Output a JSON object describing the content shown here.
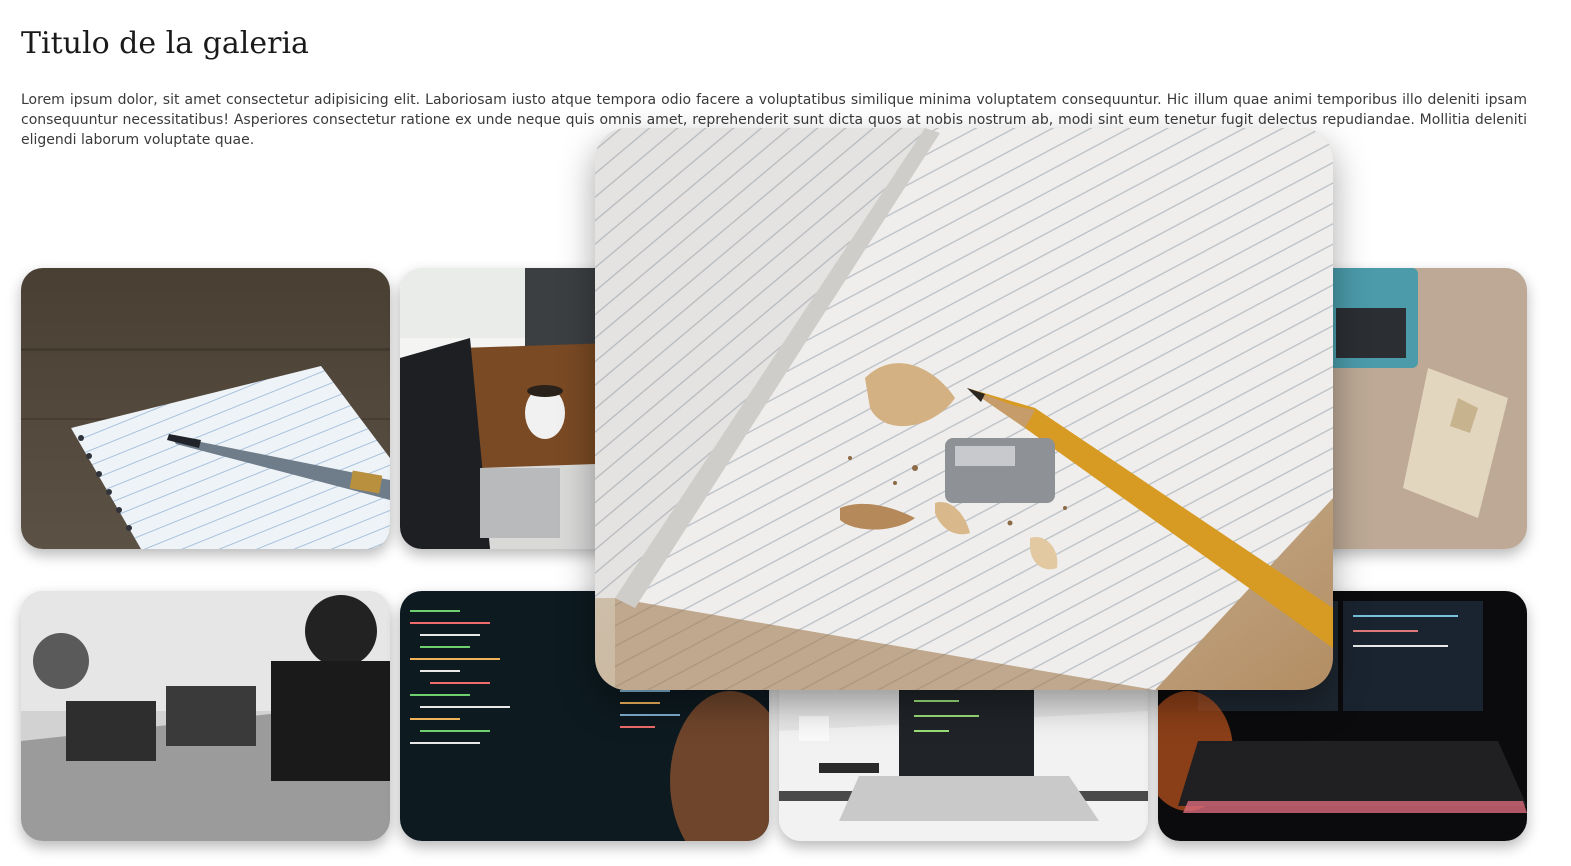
{
  "gallery": {
    "title": "Titulo de la galeria",
    "description": "Lorem ipsum dolor, sit amet consectetur adipisicing elit. Laboriosam iusto atque tempora odio facere a voluptatibus similique minima voluptatem consequuntur. Hic illum quae animi temporibus illo deleniti ipsam consequuntur necessitatibus! Asperiores consectetur ratione ex unde neque quis omnis amet, reprehenderit sunt dicta quos at nobis nostrum ab, modi sint eum tenetur fugit delectus repudiandae. Mollitia deleniti eligendi laborum voluptate quae."
  },
  "images": [
    {
      "id": "notebook-fountain-pen",
      "subject": "notebook with fountain pen"
    },
    {
      "id": "laptop-coffee",
      "subject": "laptop and coffee mug by window"
    },
    {
      "id": "typewriter-notebook",
      "subject": "typewriter and patterned notebook"
    },
    {
      "id": "people-working-bw",
      "subject": "people working at laptops, black and white"
    },
    {
      "id": "code-screen",
      "subject": "person looking at code on screen"
    },
    {
      "id": "laptop-desk",
      "subject": "laptop on white desk"
    },
    {
      "id": "keyboard-monitors",
      "subject": "glowing keyboard and monitors"
    }
  ],
  "featured": {
    "id": "notebook-pencil-shavings",
    "subject": "open notebook with pencil and shavings"
  },
  "colors": {
    "background": "#ffffff",
    "title": "#1a1a1a",
    "text": "#3a3a3a"
  }
}
